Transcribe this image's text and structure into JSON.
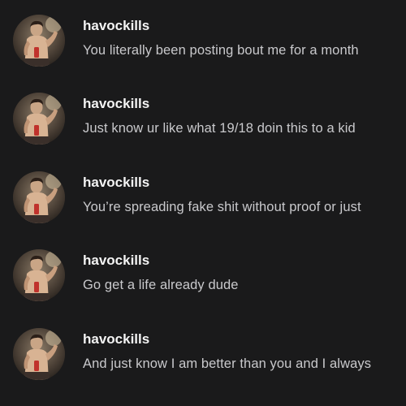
{
  "messages": [
    {
      "username": "havockills",
      "text": "You literally been posting bout me for a month"
    },
    {
      "username": "havockills",
      "text": "Just know ur like what 19/18 doin this to a kid"
    },
    {
      "username": "havockills",
      "text": "You’re spreading fake shit without proof or just"
    },
    {
      "username": "havockills",
      "text": "Go get a life already dude"
    },
    {
      "username": "havockills",
      "text": "And just know I am better than you and I always"
    }
  ],
  "colors": {
    "background": "#1a1a1b",
    "username": "#f4f4f4",
    "message_text": "#c9c9cc"
  },
  "icons": {
    "avatar": "profile-photo-avatar"
  }
}
